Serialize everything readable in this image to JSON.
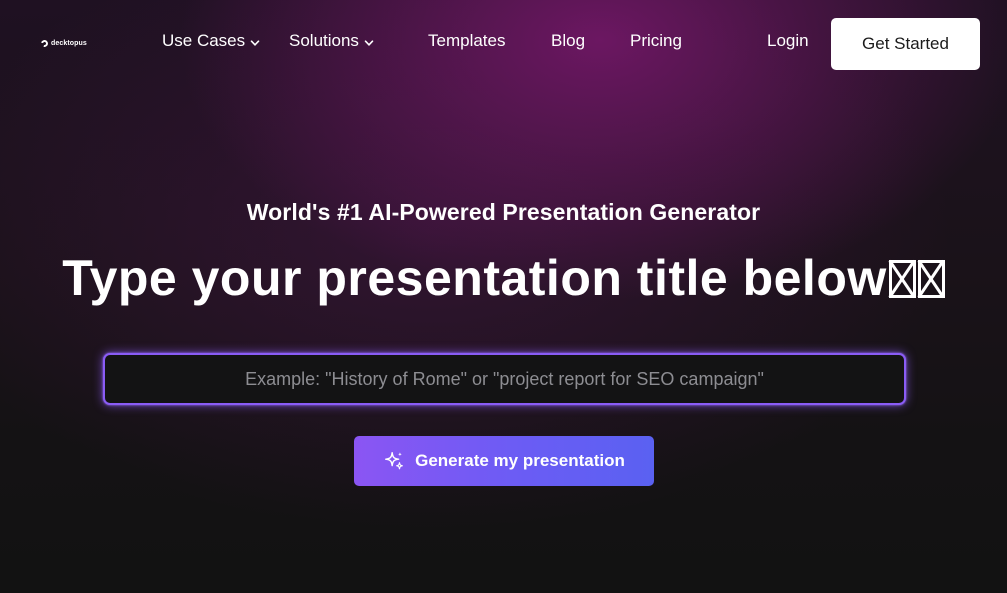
{
  "nav": {
    "logo": "decktopus",
    "items": [
      {
        "label": "Use Cases",
        "dropdown": true
      },
      {
        "label": "Solutions",
        "dropdown": true
      },
      {
        "label": "Templates",
        "dropdown": false
      },
      {
        "label": "Blog",
        "dropdown": false
      },
      {
        "label": "Pricing",
        "dropdown": false
      }
    ],
    "login": "Login",
    "cta": "Get Started"
  },
  "hero": {
    "subtitle": "World's #1 AI-Powered Presentation Generator",
    "headline": "Type your presentation title below",
    "input_placeholder": "Example: \"History of Rome\" or \"project report for SEO campaign\"",
    "input_value": "",
    "button_label": "Generate my presentation",
    "button_icon": "sparkles-icon"
  },
  "colors": {
    "accent": "#8b5cf6",
    "button_gradient_start": "#8b55f3",
    "button_gradient_end": "#5a61f2",
    "background_dark": "#121212",
    "background_glow": "#78186c"
  }
}
